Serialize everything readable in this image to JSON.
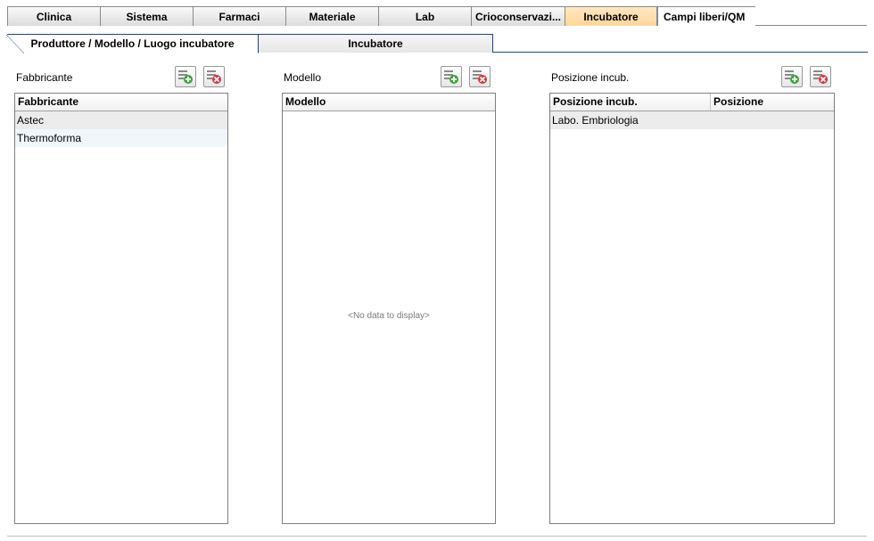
{
  "top_tabs": [
    {
      "label": "Clinica",
      "active": false
    },
    {
      "label": "Sistema",
      "active": false
    },
    {
      "label": "Farmaci",
      "active": false
    },
    {
      "label": "Materiale",
      "active": false
    },
    {
      "label": "Lab",
      "active": false
    },
    {
      "label": "Crioconservazi...",
      "active": false
    },
    {
      "label": "Incubatore",
      "active": true
    },
    {
      "label": "Campi liberi/QM",
      "active": false
    }
  ],
  "sub_tabs": [
    {
      "label": "Produttore / Modello / Luogo incubatore",
      "active": true
    },
    {
      "label": "Incubatore",
      "active": false
    }
  ],
  "panels": {
    "manufacturer": {
      "title": "Fabbricante",
      "columns": [
        "Fabbricante"
      ],
      "rows": [
        [
          "Astec"
        ],
        [
          "Thermoforma"
        ]
      ]
    },
    "model": {
      "title": "Modello",
      "columns": [
        "Modello"
      ],
      "rows": [],
      "empty_text": "<No data to display>"
    },
    "location": {
      "title": "Posizione incub.",
      "columns": [
        "Posizione incub.",
        "Posizione"
      ],
      "rows": [
        [
          "Labo. Embriologia",
          ""
        ]
      ]
    }
  },
  "icons": {
    "add": "add-record-icon",
    "delete": "delete-record-icon"
  },
  "colors": {
    "active_tab": "#ffd79a",
    "sub_tab_border": "#1c3f94",
    "add_green": "#3aa53a",
    "delete_red": "#d8333a"
  }
}
